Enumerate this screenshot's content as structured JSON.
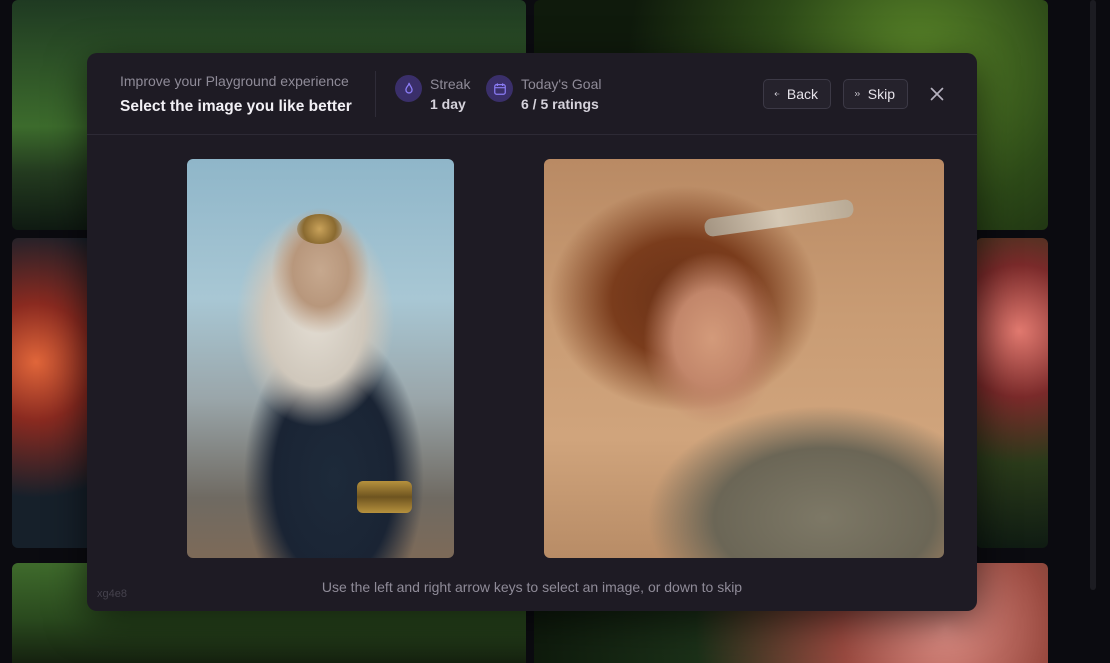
{
  "modal": {
    "subtitle": "Improve your Playground experience",
    "title": "Select the image you like better",
    "streak": {
      "label": "Streak",
      "value": "1 day",
      "icon": "flame-icon"
    },
    "goal": {
      "label": "Today's Goal",
      "value": "6 / 5 ratings",
      "icon": "calendar-icon"
    },
    "back_label": "Back",
    "skip_label": "Skip",
    "hint": "Use the left and right arrow keys to select an image, or down to skip",
    "code": "xg4e8"
  },
  "colors": {
    "modal_bg": "#1e1b24",
    "accent": "#3a2f6a",
    "accent_icon": "#8b7cf6"
  }
}
